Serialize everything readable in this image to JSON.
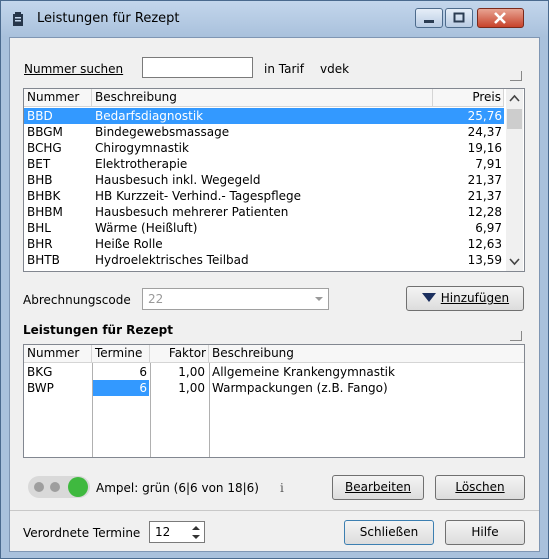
{
  "window": {
    "title": "Leistungen für Rezept"
  },
  "search": {
    "label": "Nummer suchen",
    "value": "",
    "tarif_label": "in Tarif",
    "tarif_value": "vdek"
  },
  "catalog": {
    "columns": [
      "Nummer",
      "Beschreibung",
      "Preis"
    ],
    "selected_index": 0,
    "rows": [
      {
        "nummer": "BBD",
        "beschreibung": "Bedarfsdiagnostik",
        "preis": "25,76"
      },
      {
        "nummer": "BBGM",
        "beschreibung": "Bindegewebsmassage",
        "preis": "24,37"
      },
      {
        "nummer": "BCHG",
        "beschreibung": "Chirogymnastik",
        "preis": "19,16"
      },
      {
        "nummer": "BET",
        "beschreibung": "Elektrotherapie",
        "preis": "7,91"
      },
      {
        "nummer": "BHB",
        "beschreibung": "Hausbesuch inkl. Wegegeld",
        "preis": "21,37"
      },
      {
        "nummer": "BHBK",
        "beschreibung": "HB Kurzzeit- Verhind.- Tagespflege",
        "preis": "21,37"
      },
      {
        "nummer": "BHBM",
        "beschreibung": "Hausbesuch mehrerer Patienten",
        "preis": "12,28"
      },
      {
        "nummer": "BHL",
        "beschreibung": "Wärme (Heißluft)",
        "preis": "6,97"
      },
      {
        "nummer": "BHR",
        "beschreibung": "Heiße Rolle",
        "preis": "12,63"
      },
      {
        "nummer": "BHTB",
        "beschreibung": "Hydroelektrisches Teilbad",
        "preis": "13,59"
      }
    ]
  },
  "abrechnung": {
    "label": "Abrechnungscode",
    "value": "22",
    "add_button": "Hinzufügen"
  },
  "rezept": {
    "heading": "Leistungen für Rezept",
    "columns": [
      "Nummer",
      "Termine",
      "Faktor",
      "Beschreibung"
    ],
    "rows": [
      {
        "nummer": "BKG",
        "termine": "6",
        "faktor": "1,00",
        "beschreibung": "Allgemeine Krankengymnastik"
      },
      {
        "nummer": "BWP",
        "termine": "6",
        "faktor": "1,00",
        "beschreibung": "Warmpackungen (z.B. Fango)"
      }
    ]
  },
  "status": {
    "ampel_text": "Ampel: grün (6|6 von 18|6)",
    "info_glyph": "i",
    "ampel_active_color": "#3fb93f",
    "edit_button": "Bearbeiten",
    "delete_button": "Löschen"
  },
  "footer": {
    "verordnete_label": "Verordnete Termine",
    "verordnete_value": "12",
    "close_button": "Schließen",
    "help_button": "Hilfe"
  }
}
